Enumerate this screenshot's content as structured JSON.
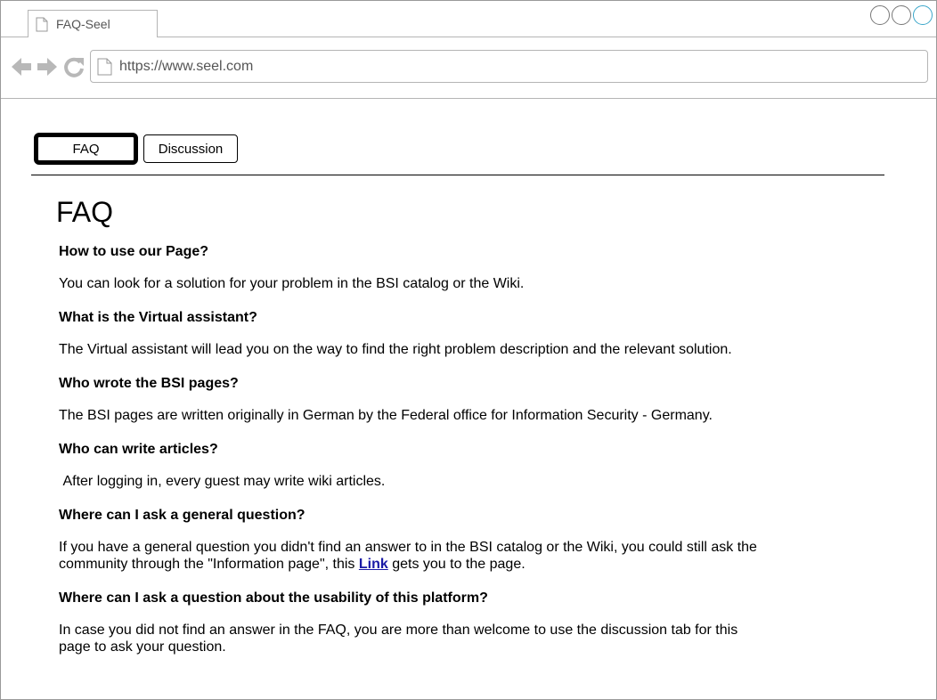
{
  "browser": {
    "tab_title": "FAQ-Seel",
    "url": "https://www.seel.com"
  },
  "tabs": {
    "faq_label": "FAQ",
    "discussion_label": "Discussion"
  },
  "page": {
    "title": "FAQ",
    "faqs": [
      {
        "question": "How to use our Page?",
        "answer": "You can look for a solution for your problem in the BSI catalog or the Wiki."
      },
      {
        "question": "What is the Virtual assistant?",
        "answer": "The Virtual assistant will lead you on the way to find the right problem description and the relevant solution."
      },
      {
        "question": "Who wrote the BSI pages?",
        "answer": "The BSI pages are written originally in German by the Federal office for Information Security - Germany."
      },
      {
        "question": "Who can write articles?",
        "answer": " After logging in, every guest may write wiki articles."
      },
      {
        "question": "Where can I ask a general question?",
        "answer_before_link": "If you have a general question you didn't find an answer to in the BSI catalog or the Wiki, you could still ask the community through the \"Information page\", this ",
        "link_text": "Link",
        "answer_after_link": " gets you to the page."
      },
      {
        "question": "Where can I ask a question about the usability of this platform?",
        "answer": "In case you did not find an answer in the FAQ, you are more than welcome to use the discussion tab for this page to ask your question."
      }
    ]
  },
  "icons": {
    "back": "back-arrow-icon",
    "forward": "forward-arrow-icon",
    "reload": "reload-icon",
    "page": "page-icon",
    "window_controls": [
      "window-circle-icon",
      "window-circle-icon",
      "window-circle-icon"
    ]
  },
  "colors": {
    "link": "#1a1aa6",
    "window_active": "#3aa6c9"
  }
}
